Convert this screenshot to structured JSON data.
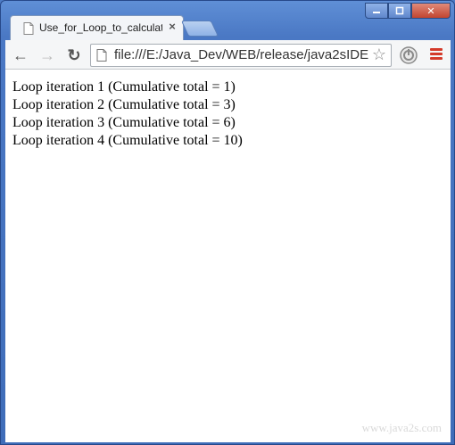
{
  "tab": {
    "title": "Use_for_Loop_to_calculate",
    "close": "×"
  },
  "toolbar": {
    "back": "←",
    "forward": "→",
    "reload": "↻",
    "url": "file:///E:/Java_Dev/WEB/release/java2sIDE",
    "star": "☆"
  },
  "window_controls": {
    "close": "✕"
  },
  "page": {
    "lines": [
      "Loop iteration 1 (Cumulative total = 1)",
      "Loop iteration 2 (Cumulative total = 3)",
      "Loop iteration 3 (Cumulative total = 6)",
      "Loop iteration 4 (Cumulative total = 10)"
    ],
    "watermark": "www.java2s.com"
  },
  "colors": {
    "frame": "#4a78c4",
    "menu_accent": "#d43a2a"
  }
}
